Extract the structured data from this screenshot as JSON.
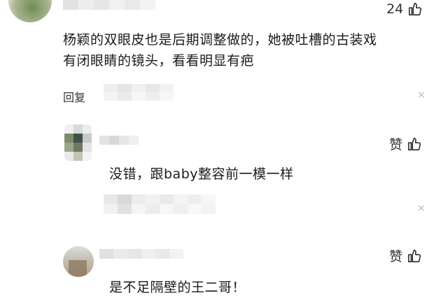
{
  "comment1": {
    "like_count": "24",
    "text_line1": "杨颖的双眼皮也是后期调整做的，她被吐槽的古装戏",
    "text_line2": "有闭眼睛的镜头，看看明显有疤",
    "reply_label": "回复",
    "close_glyph": "×"
  },
  "reply1": {
    "like_label": "赞",
    "text": "没错，跟baby整容前一模一样",
    "close_glyph": "×"
  },
  "reply2": {
    "like_label": "赞",
    "text": "是不足隔壁的王二哥！"
  },
  "colors": {
    "text": "#1a1a1a",
    "muted": "#b8b8b8",
    "mosaic_light": "#e9e9e9",
    "avatar_green": "#6e8a58"
  },
  "icons": [
    "thumbs-up-icon",
    "close-icon"
  ]
}
